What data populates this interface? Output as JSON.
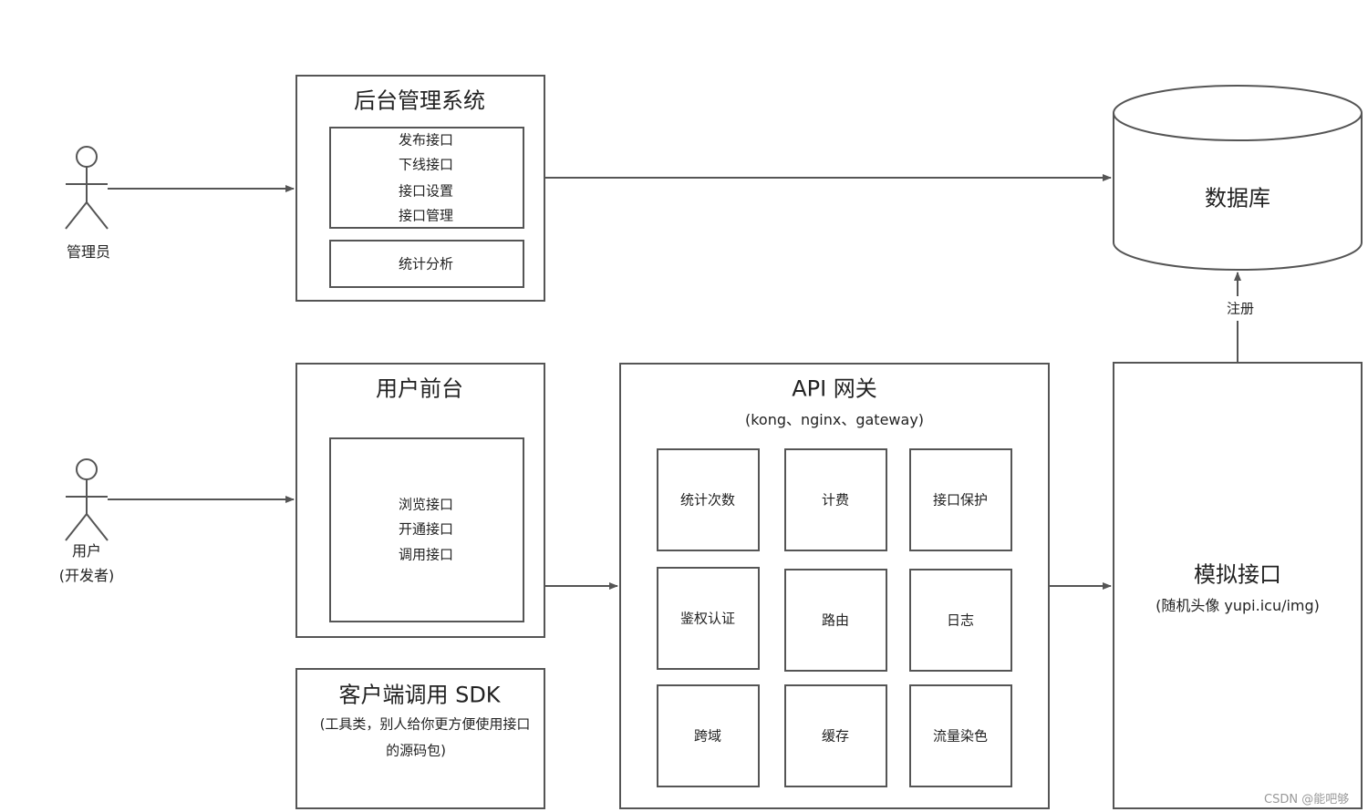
{
  "actors": {
    "admin": {
      "label": "管理员"
    },
    "user": {
      "label": "用户",
      "sublabel": "(开发者)"
    }
  },
  "admin_system": {
    "title": "后台管理系统",
    "features": [
      "发布接口",
      "下线接口",
      "接口设置",
      "接口管理"
    ],
    "stats": "统计分析"
  },
  "database": {
    "label": "数据库"
  },
  "register_label": "注册",
  "user_frontend": {
    "title": "用户前台",
    "features": [
      "浏览接口",
      "开通接口",
      "调用接口"
    ]
  },
  "sdk": {
    "title": "客户端调用 SDK",
    "description_line1": "(工具类，别人给你更方便使用接口",
    "description_line2": "的源码包)"
  },
  "gateway": {
    "title": "API 网关",
    "subtitle": "(kong、nginx、gateway)",
    "modules": [
      "统计次数",
      "计费",
      "接口保护",
      "鉴权认证",
      "路由",
      "日志",
      "跨域",
      "缓存",
      "流量染色"
    ]
  },
  "mock_api": {
    "title": "模拟接口",
    "subtitle": "(随机头像 yupi.icu/img)"
  },
  "watermark": "CSDN @能吧够",
  "colors": {
    "stroke": "#555555",
    "text": "#222222"
  }
}
